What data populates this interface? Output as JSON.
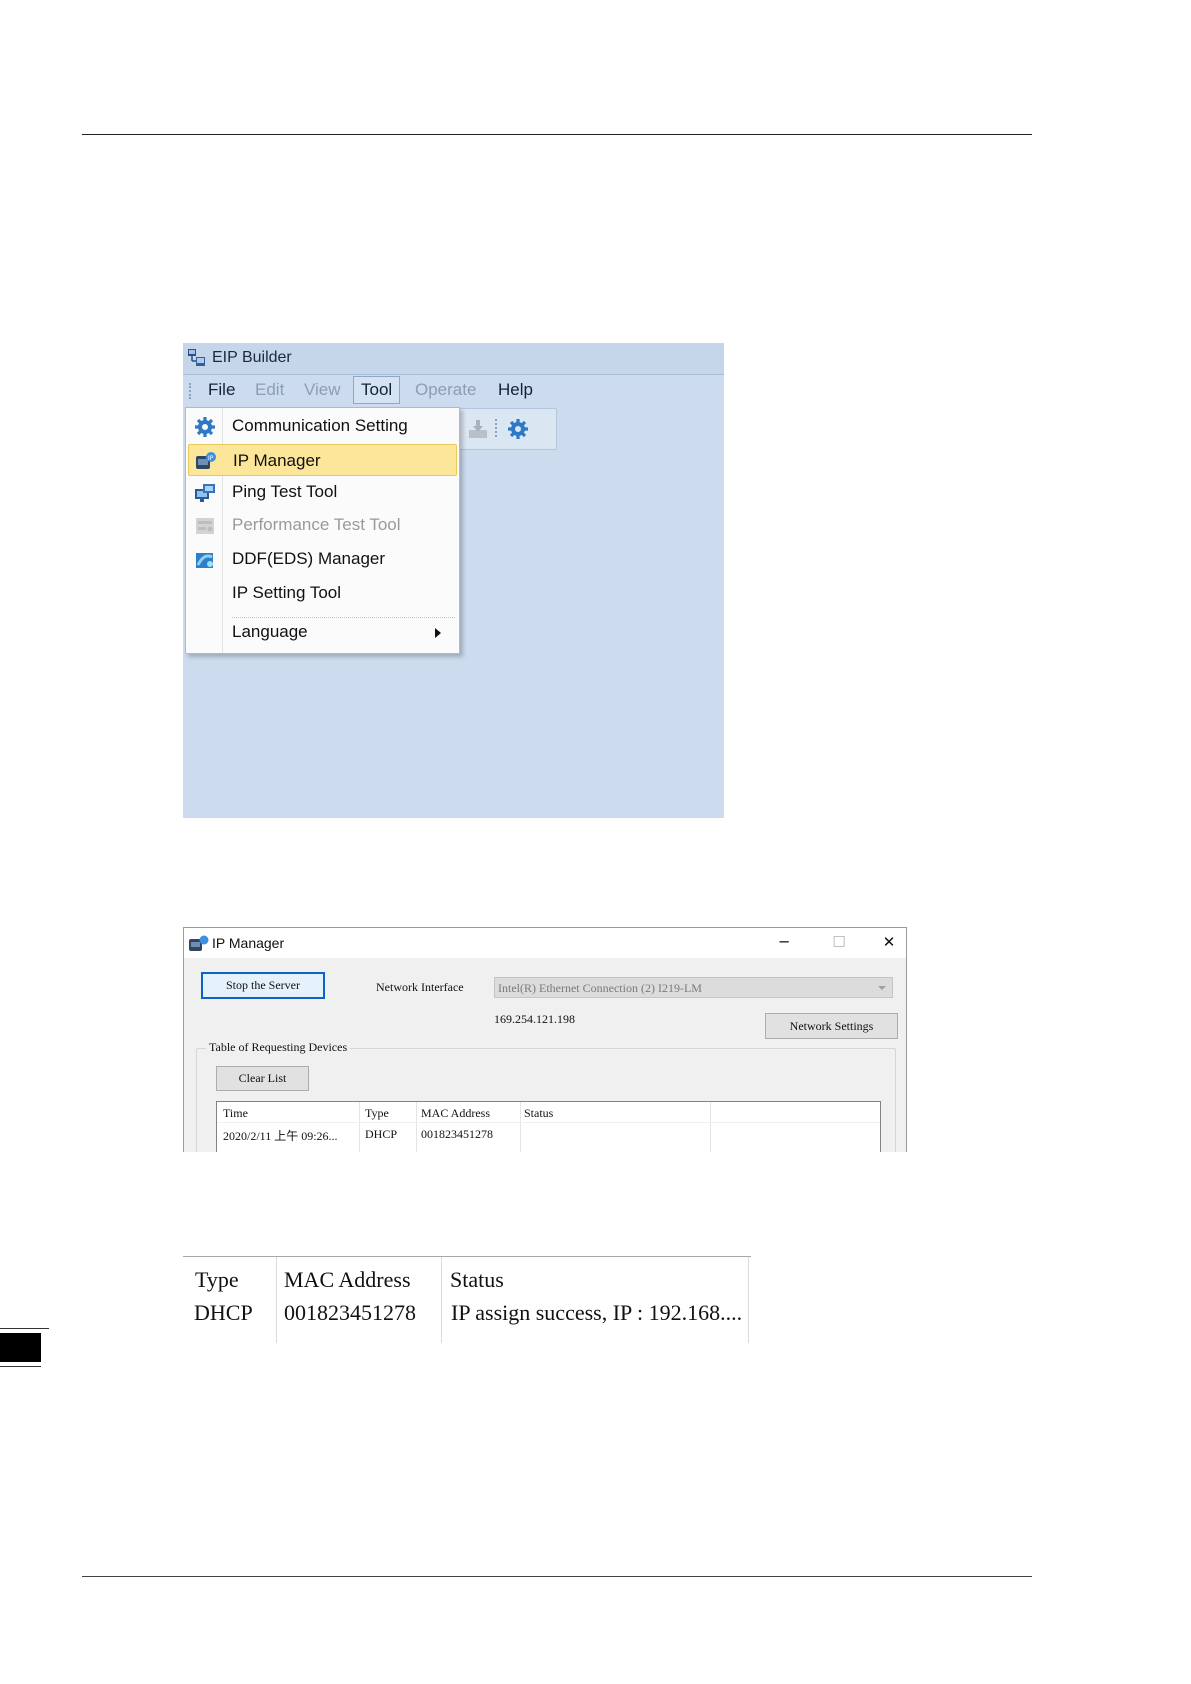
{
  "eip_builder": {
    "window_title": "EIP Builder",
    "menu": [
      "File",
      "Edit",
      "View",
      "Tool",
      "Operate",
      "Help"
    ],
    "tool_menu_items": [
      {
        "label": "Communication Setting",
        "icon": "gear-icon"
      },
      {
        "label": "IP Manager",
        "icon": "ip-manager-icon"
      },
      {
        "label": "Ping Test Tool",
        "icon": "network-icon"
      },
      {
        "label": "Performance Test Tool",
        "icon": "performance-icon"
      },
      {
        "label": "DDF(EDS) Manager",
        "icon": "eds-manager-icon"
      },
      {
        "label": "IP Setting Tool",
        "icon": ""
      },
      {
        "label": "Language",
        "icon": ""
      }
    ]
  },
  "ip_manager": {
    "window_title": "IP Manager",
    "stop_server_label": "Stop the Server",
    "network_interface_label": "Network Interface",
    "network_interface_value": "Intel(R) Ethernet Connection (2) I219-LM",
    "ip_address": "169.254.121.198",
    "network_settings_label": "Network Settings",
    "group_label": "Table of Requesting Devices",
    "clear_list_label": "Clear List",
    "columns": [
      "Time",
      "Type",
      "MAC Address",
      "Status"
    ],
    "rows": [
      {
        "time": "2020/2/11 上午 09:26...",
        "type": "DHCP",
        "mac": "001823451278",
        "status": ""
      }
    ]
  },
  "zoom_table": {
    "columns": [
      "Type",
      "MAC Address",
      "Status"
    ],
    "row": {
      "type": "DHCP",
      "mac": "001823451278",
      "status": "IP assign success, IP : 192.168...."
    }
  },
  "colors": {
    "eip_background": "#ccdcee",
    "menu_highlight": "#fbe69a",
    "focus_border": "#0a64c8"
  }
}
